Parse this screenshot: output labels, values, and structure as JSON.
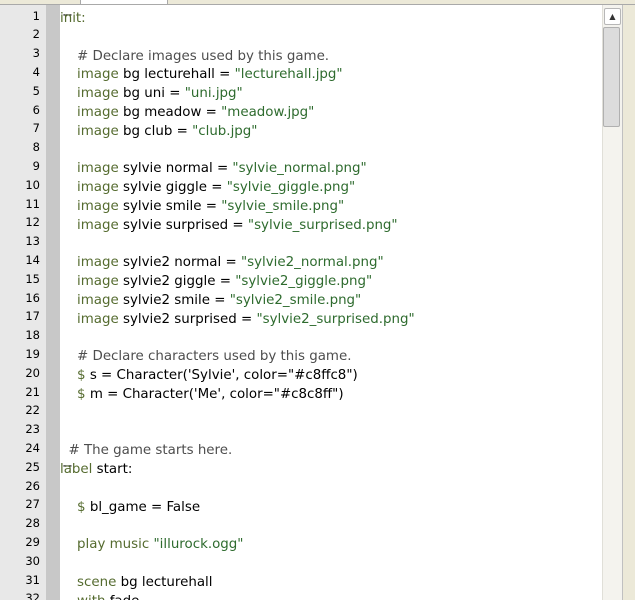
{
  "editor": {
    "lines": [
      {
        "n": "1",
        "fold": "−",
        "segs": [
          {
            "t": "init:",
            "c": "kw"
          }
        ]
      },
      {
        "n": "2",
        "segs": []
      },
      {
        "n": "3",
        "segs": [
          {
            "t": "    # Declare images used by this game.",
            "c": "cm"
          }
        ]
      },
      {
        "n": "4",
        "segs": [
          {
            "t": "    "
          },
          {
            "t": "image",
            "c": "kw"
          },
          {
            "t": " bg lecturehall = "
          },
          {
            "t": "\"lecturehall.jpg\"",
            "c": "str"
          }
        ]
      },
      {
        "n": "5",
        "segs": [
          {
            "t": "    "
          },
          {
            "t": "image",
            "c": "kw"
          },
          {
            "t": " bg uni = "
          },
          {
            "t": "\"uni.jpg\"",
            "c": "str"
          }
        ]
      },
      {
        "n": "6",
        "segs": [
          {
            "t": "    "
          },
          {
            "t": "image",
            "c": "kw"
          },
          {
            "t": " bg meadow = "
          },
          {
            "t": "\"meadow.jpg\"",
            "c": "str"
          }
        ]
      },
      {
        "n": "7",
        "segs": [
          {
            "t": "    "
          },
          {
            "t": "image",
            "c": "kw"
          },
          {
            "t": " bg club = "
          },
          {
            "t": "\"club.jpg\"",
            "c": "str"
          }
        ]
      },
      {
        "n": "8",
        "segs": []
      },
      {
        "n": "9",
        "segs": [
          {
            "t": "    "
          },
          {
            "t": "image",
            "c": "kw"
          },
          {
            "t": " sylvie normal = "
          },
          {
            "t": "\"sylvie_normal.png\"",
            "c": "str"
          }
        ]
      },
      {
        "n": "10",
        "segs": [
          {
            "t": "    "
          },
          {
            "t": "image",
            "c": "kw"
          },
          {
            "t": " sylvie giggle = "
          },
          {
            "t": "\"sylvie_giggle.png\"",
            "c": "str"
          }
        ]
      },
      {
        "n": "11",
        "segs": [
          {
            "t": "    "
          },
          {
            "t": "image",
            "c": "kw"
          },
          {
            "t": " sylvie smile = "
          },
          {
            "t": "\"sylvie_smile.png\"",
            "c": "str"
          }
        ]
      },
      {
        "n": "12",
        "segs": [
          {
            "t": "    "
          },
          {
            "t": "image",
            "c": "kw"
          },
          {
            "t": " sylvie surprised = "
          },
          {
            "t": "\"sylvie_surprised.png\"",
            "c": "str"
          }
        ]
      },
      {
        "n": "13",
        "segs": []
      },
      {
        "n": "14",
        "segs": [
          {
            "t": "    "
          },
          {
            "t": "image",
            "c": "kw"
          },
          {
            "t": " sylvie2 normal = "
          },
          {
            "t": "\"sylvie2_normal.png\"",
            "c": "str"
          }
        ]
      },
      {
        "n": "15",
        "segs": [
          {
            "t": "    "
          },
          {
            "t": "image",
            "c": "kw"
          },
          {
            "t": " sylvie2 giggle = "
          },
          {
            "t": "\"sylvie2_giggle.png\"",
            "c": "str"
          }
        ]
      },
      {
        "n": "16",
        "segs": [
          {
            "t": "    "
          },
          {
            "t": "image",
            "c": "kw"
          },
          {
            "t": " sylvie2 smile = "
          },
          {
            "t": "\"sylvie2_smile.png\"",
            "c": "str"
          }
        ]
      },
      {
        "n": "17",
        "segs": [
          {
            "t": "    "
          },
          {
            "t": "image",
            "c": "kw"
          },
          {
            "t": " sylvie2 surprised = "
          },
          {
            "t": "\"sylvie2_surprised.png\"",
            "c": "str"
          }
        ]
      },
      {
        "n": "18",
        "segs": []
      },
      {
        "n": "19",
        "segs": [
          {
            "t": "    # Declare characters used by this game.",
            "c": "cm"
          }
        ]
      },
      {
        "n": "20",
        "segs": [
          {
            "t": "    "
          },
          {
            "t": "$",
            "c": "kw"
          },
          {
            "t": " s = Character('Sylvie', color=\"#c8ffc8\")"
          }
        ]
      },
      {
        "n": "21",
        "segs": [
          {
            "t": "    "
          },
          {
            "t": "$",
            "c": "kw"
          },
          {
            "t": " m = Character('Me', color=\"#c8c8ff\")"
          }
        ]
      },
      {
        "n": "22",
        "segs": []
      },
      {
        "n": "23",
        "segs": []
      },
      {
        "n": "24",
        "segs": [
          {
            "t": "  # The game starts here.",
            "c": "cm"
          }
        ]
      },
      {
        "n": "25",
        "fold": "−",
        "segs": [
          {
            "t": "label",
            "c": "kw"
          },
          {
            "t": " start:"
          }
        ]
      },
      {
        "n": "26",
        "segs": []
      },
      {
        "n": "27",
        "segs": [
          {
            "t": "    "
          },
          {
            "t": "$",
            "c": "kw"
          },
          {
            "t": " bl_game = False"
          }
        ]
      },
      {
        "n": "28",
        "segs": []
      },
      {
        "n": "29",
        "segs": [
          {
            "t": "    "
          },
          {
            "t": "play music",
            "c": "kw"
          },
          {
            "t": " "
          },
          {
            "t": "\"illurock.ogg\"",
            "c": "str"
          }
        ]
      },
      {
        "n": "30",
        "segs": []
      },
      {
        "n": "31",
        "segs": [
          {
            "t": "    "
          },
          {
            "t": "scene",
            "c": "kw"
          },
          {
            "t": " bg lecturehall"
          }
        ]
      },
      {
        "n": "32",
        "segs": [
          {
            "t": "    "
          },
          {
            "t": "with",
            "c": "kw"
          },
          {
            "t": " fade"
          }
        ]
      }
    ],
    "scroll_up_icon": "▲",
    "colors": {
      "keyword": "#556b2f",
      "string": "#2e6b2e",
      "comment": "#4d4d4d",
      "gutter": "#e8e8e8",
      "fold_column": "#c8c8c8"
    }
  }
}
